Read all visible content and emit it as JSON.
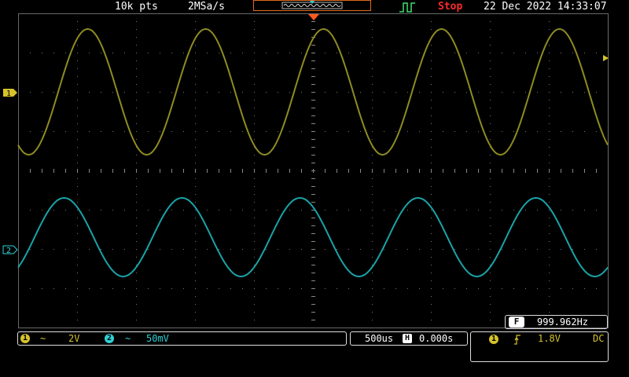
{
  "header": {
    "record_length": "10k pts",
    "sample_rate": "2MSa/s",
    "run_state": "Stop",
    "datetime": "22 Dec 2022 14:33:07"
  },
  "channels": [
    {
      "id": "1",
      "coupling": "~",
      "scale": "2V",
      "color": "#d6c32a"
    },
    {
      "id": "2",
      "coupling": "~",
      "scale": "50mV",
      "color": "#2fd0d6"
    }
  ],
  "timebase": {
    "scale": "500us",
    "position_icon": "H",
    "position": "0.000s"
  },
  "trigger": {
    "source": "1",
    "slope_icon": "rising-edge",
    "level": "1.8V",
    "coupling": "DC"
  },
  "frequency": {
    "icon": "F",
    "value": "999.962Hz"
  },
  "colors": {
    "ch1_trace": "#8f8c22",
    "ch2_trace": "#1aa3a8",
    "run_state": "#ff2a2a",
    "accent": "#e06a1a",
    "grid": "#5a5a5a",
    "trigger_arrow": "#ff5a1e"
  }
}
